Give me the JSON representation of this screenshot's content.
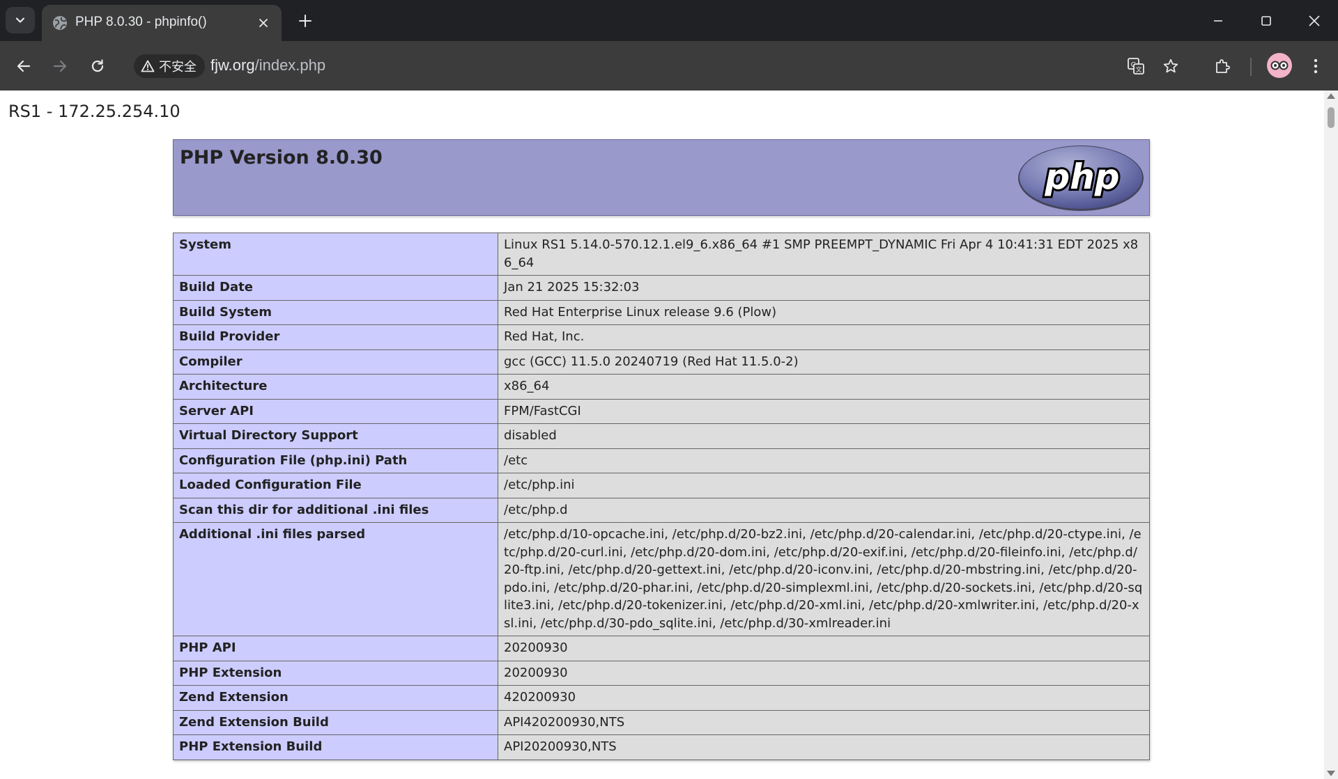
{
  "browser": {
    "tab_title": "PHP 8.0.30 - phpinfo()",
    "security_label": "不安全",
    "url_host": "fjw.org",
    "url_path": "/index.php"
  },
  "page": {
    "server_label": "RS1 - 172.25.254.10",
    "php_version": "PHP Version 8.0.30",
    "logo_text": "php"
  },
  "info_rows": [
    {
      "key": "System",
      "value": "Linux RS1 5.14.0-570.12.1.el9_6.x86_64 #1 SMP PREEMPT_DYNAMIC Fri Apr 4 10:41:31 EDT 2025 x86_64"
    },
    {
      "key": "Build Date",
      "value": "Jan 21 2025 15:32:03"
    },
    {
      "key": "Build System",
      "value": "Red Hat Enterprise Linux release 9.6 (Plow)"
    },
    {
      "key": "Build Provider",
      "value": "Red Hat, Inc."
    },
    {
      "key": "Compiler",
      "value": "gcc (GCC) 11.5.0 20240719 (Red Hat 11.5.0-2)"
    },
    {
      "key": "Architecture",
      "value": "x86_64"
    },
    {
      "key": "Server API",
      "value": "FPM/FastCGI"
    },
    {
      "key": "Virtual Directory Support",
      "value": "disabled"
    },
    {
      "key": "Configuration File (php.ini) Path",
      "value": "/etc"
    },
    {
      "key": "Loaded Configuration File",
      "value": "/etc/php.ini"
    },
    {
      "key": "Scan this dir for additional .ini files",
      "value": "/etc/php.d"
    },
    {
      "key": "Additional .ini files parsed",
      "value": "/etc/php.d/10-opcache.ini, /etc/php.d/20-bz2.ini, /etc/php.d/20-calendar.ini, /etc/php.d/20-ctype.ini, /etc/php.d/20-curl.ini, /etc/php.d/20-dom.ini, /etc/php.d/20-exif.ini, /etc/php.d/20-fileinfo.ini, /etc/php.d/20-ftp.ini, /etc/php.d/20-gettext.ini, /etc/php.d/20-iconv.ini, /etc/php.d/20-mbstring.ini, /etc/php.d/20-pdo.ini, /etc/php.d/20-phar.ini, /etc/php.d/20-simplexml.ini, /etc/php.d/20-sockets.ini, /etc/php.d/20-sqlite3.ini, /etc/php.d/20-tokenizer.ini, /etc/php.d/20-xml.ini, /etc/php.d/20-xmlwriter.ini, /etc/php.d/20-xsl.ini, /etc/php.d/30-pdo_sqlite.ini, /etc/php.d/30-xmlreader.ini"
    },
    {
      "key": "PHP API",
      "value": "20200930"
    },
    {
      "key": "PHP Extension",
      "value": "20200930"
    },
    {
      "key": "Zend Extension",
      "value": "420200930"
    },
    {
      "key": "Zend Extension Build",
      "value": "API420200930,NTS"
    },
    {
      "key": "PHP Extension Build",
      "value": "API20200930,NTS"
    }
  ],
  "colors": {
    "header_bg": "#9999cc",
    "key_cell_bg": "#ccccff",
    "value_cell_bg": "#dddddd",
    "chrome_dark": "#202124",
    "chrome_toolbar": "#3c3c3c"
  }
}
